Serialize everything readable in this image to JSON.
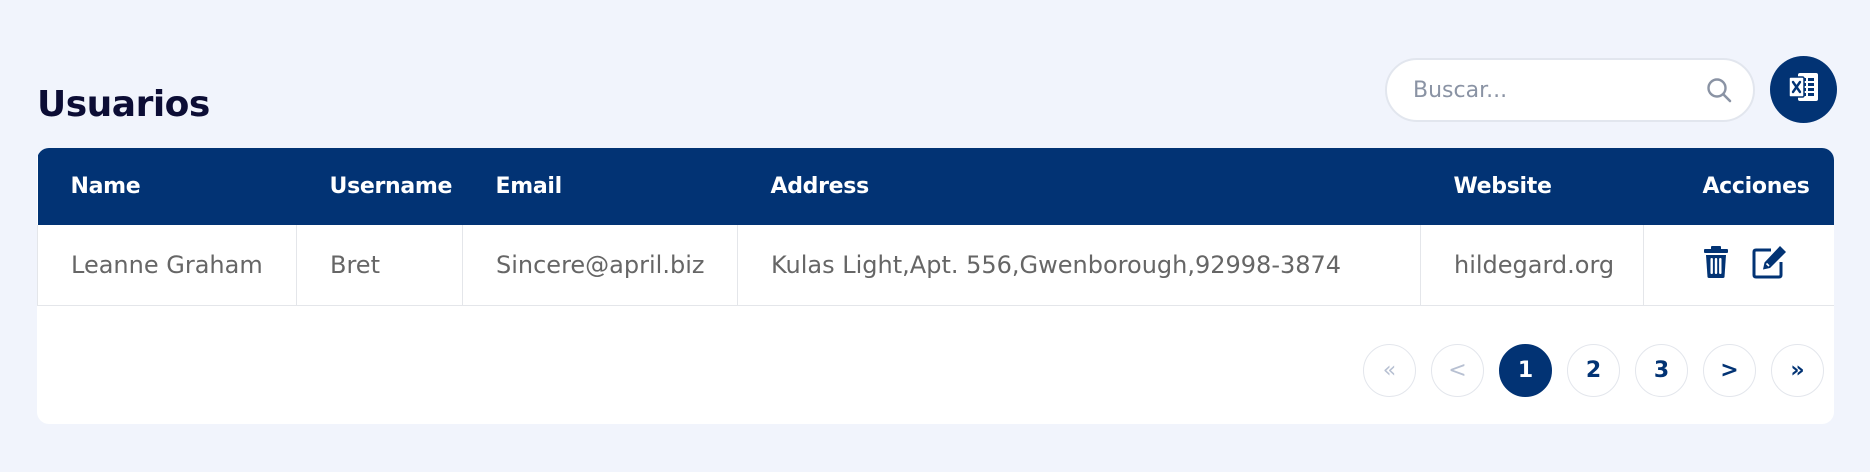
{
  "page": {
    "title": "Usuarios"
  },
  "search": {
    "placeholder": "Buscar..."
  },
  "toolbar": {
    "export_icon": "excel-icon"
  },
  "colors": {
    "primary": "#023374",
    "background": "#f1f4fc",
    "title": "#0c0d35",
    "cell_text": "#666666"
  },
  "table": {
    "columns": [
      "Name",
      "Username",
      "Email",
      "Address",
      "Website",
      "Acciones"
    ],
    "rows": [
      {
        "name": "Leanne Graham",
        "username": "Bret",
        "email": "Sincere@april.biz",
        "address": "Kulas Light,Apt. 556,Gwenborough,92998-3874",
        "website": "hildegard.org",
        "actions": [
          "trash-icon",
          "edit-icon"
        ]
      }
    ]
  },
  "pagination": {
    "first": "«",
    "prev": "<",
    "pages": [
      "1",
      "2",
      "3"
    ],
    "current": "1",
    "next": ">",
    "last": "»"
  }
}
